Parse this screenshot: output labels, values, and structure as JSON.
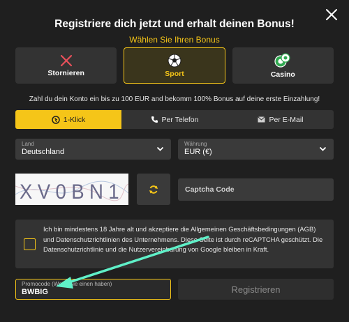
{
  "modal": {
    "title": "Registriere dich jetzt und erhalt deinen Bonus!",
    "subtitle": "Wählen Sie Ihren Bonus"
  },
  "bonus_options": [
    {
      "label": "Stornieren",
      "icon": "x-icon"
    },
    {
      "label": "Sport",
      "icon": "soccer-ball-icon",
      "selected": true
    },
    {
      "label": "Casino",
      "icon": "casino-chips-icon"
    }
  ],
  "info_text": "Zahl du dein Konto ein bis zu 100 EUR and bekomm 100% Bonus auf deine erste Einzahlung!",
  "tabs": [
    {
      "label": "1-Klick",
      "icon": "one-click-icon",
      "active": true
    },
    {
      "label": "Per Telefon",
      "icon": "phone-icon"
    },
    {
      "label": "Per E-Mail",
      "icon": "envelope-icon"
    }
  ],
  "country": {
    "label": "Land",
    "value": "Deutschland"
  },
  "currency": {
    "label": "Währung",
    "value": "EUR (€)"
  },
  "captcha": {
    "text": "XV0BN1",
    "placeholder": "Captcha Code"
  },
  "terms_text": "Ich bin mindestens 18 Jahre alt und akzeptiere die Allgemeinen Geschäftsbedingungen (AGB) und Datenschutzrichtlinien des Unternehmens. Diese Seite ist durch reCAPTCHA geschützt. Die Datenschutzrichtlinie und die Nutzervereinbarung von Google bleiben in Kraft.",
  "promo": {
    "label": "Promocode (Wenn Sie einen haben)",
    "value": "BWBIG"
  },
  "register_label": "Registrieren",
  "colors": {
    "accent": "#f5c518",
    "background": "#1f1f1f",
    "annotation_arrow": "#5ff0c8"
  }
}
